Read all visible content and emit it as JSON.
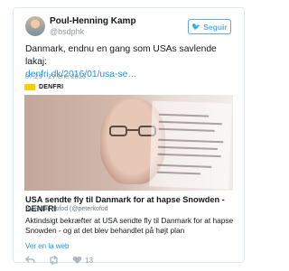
{
  "author": {
    "name": "Poul-Henning Kamp",
    "handle": "@bsdphk"
  },
  "follow_button": {
    "label": "Seguir",
    "icon": "twitter-bird-icon",
    "color": "#55acee"
  },
  "tweet": {
    "text": "Danmark, endnu en gang som USAs savlende lakaj:",
    "link": "denfri.dk/2016/01/usa-se…",
    "timestamp": "07:29 - 27 ene 2016"
  },
  "source": {
    "name": "DENFRI",
    "logo_color": "#f6d000"
  },
  "card": {
    "title": "USA sendte fly til Danmark for at hapse Snowden - DENFRI",
    "byline": "By Peter Kofod (@peterkofod",
    "description": "Aktindsigt bekræfter at USA sendte fly til Danmark for at hapse Snowden - og at det blev behandlet på højt plan"
  },
  "view_on_web": "Ver en la web",
  "actions": {
    "reply_icon": "reply-icon",
    "retweet_icon": "retweet-icon",
    "like_icon": "heart-icon",
    "likes": "13"
  }
}
